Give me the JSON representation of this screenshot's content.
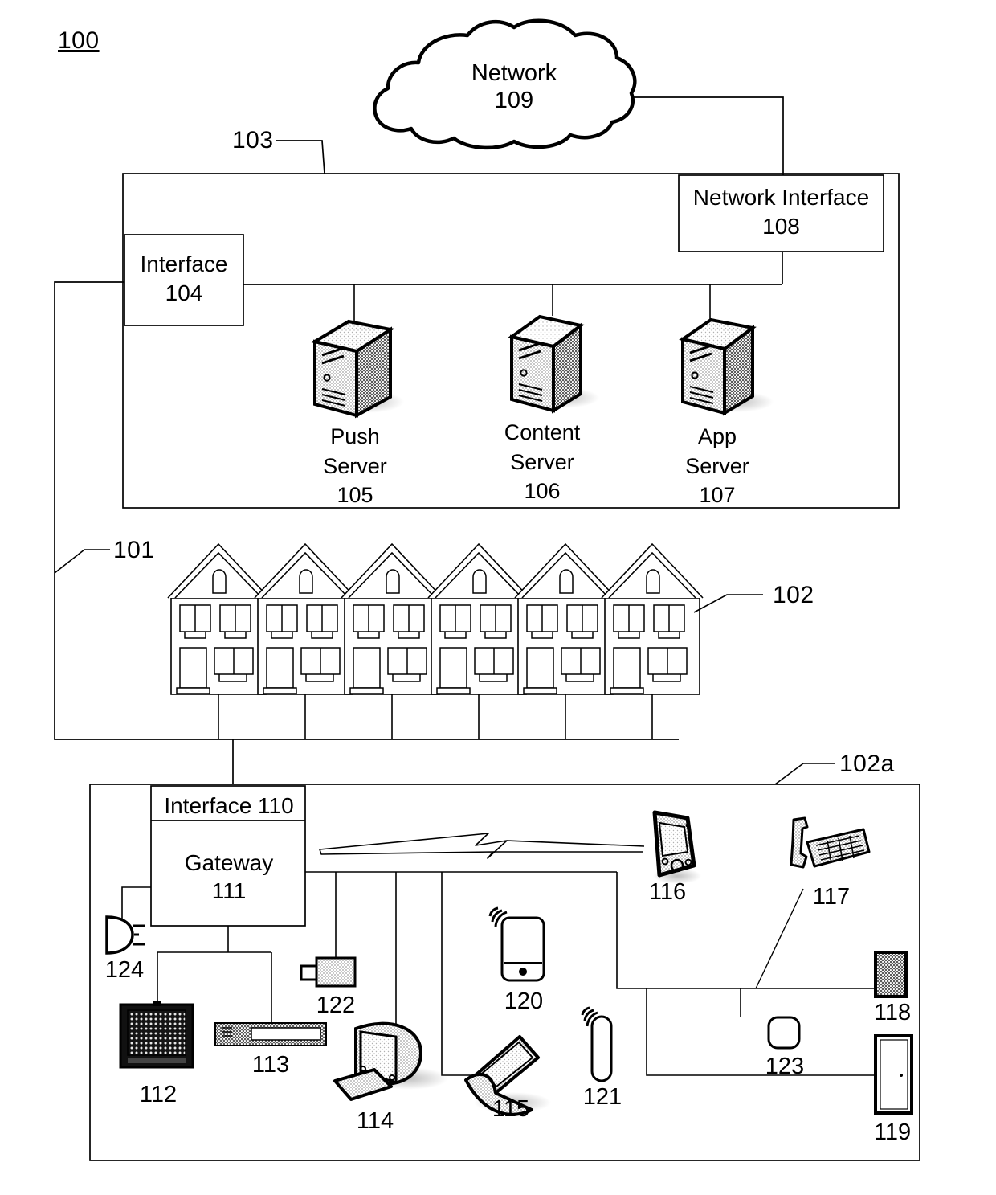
{
  "figure": {
    "number": "100"
  },
  "cloud": {
    "name": "Network",
    "ref": "109"
  },
  "head_end": {
    "ref": "103",
    "network_interface": {
      "name": "Network Interface",
      "ref": "108"
    },
    "interface": {
      "name": "Interface",
      "ref": "104"
    },
    "servers": [
      {
        "name_line1": "Push",
        "name_line2": "Server",
        "ref": "105"
      },
      {
        "name_line1": "Content",
        "name_line2": "Server",
        "ref": "106"
      },
      {
        "name_line1": "App",
        "name_line2": "Server",
        "ref": "107"
      }
    ]
  },
  "premises_area": {
    "ref": "101",
    "house_ref": "102",
    "house_count": 6
  },
  "premises_detail": {
    "ref": "102a",
    "interface": {
      "label": "Interface 110"
    },
    "gateway": {
      "name": "Gateway",
      "ref": "111"
    },
    "devices": [
      {
        "ref": "112",
        "icon": "television-icon"
      },
      {
        "ref": "113",
        "icon": "set-top-box-icon"
      },
      {
        "ref": "114",
        "icon": "desktop-computer-icon"
      },
      {
        "ref": "115",
        "icon": "laptop-icon"
      },
      {
        "ref": "116",
        "icon": "mobile-phone-icon"
      },
      {
        "ref": "117",
        "icon": "landline-telephone-icon"
      },
      {
        "ref": "118",
        "icon": "small-display-icon"
      },
      {
        "ref": "119",
        "icon": "door-panel-icon"
      },
      {
        "ref": "120",
        "icon": "wireless-tablet-icon"
      },
      {
        "ref": "121",
        "icon": "wireless-sensor-icon"
      },
      {
        "ref": "122",
        "icon": "camera-icon"
      },
      {
        "ref": "123",
        "icon": "thermostat-icon"
      },
      {
        "ref": "124",
        "icon": "speaker-icon"
      }
    ]
  },
  "colors": {
    "line": "#000000",
    "fill": "#ffffff",
    "shade_light": "#d8d8d8",
    "shade_mid": "#b4b4b4",
    "shade_dark": "#222222"
  }
}
